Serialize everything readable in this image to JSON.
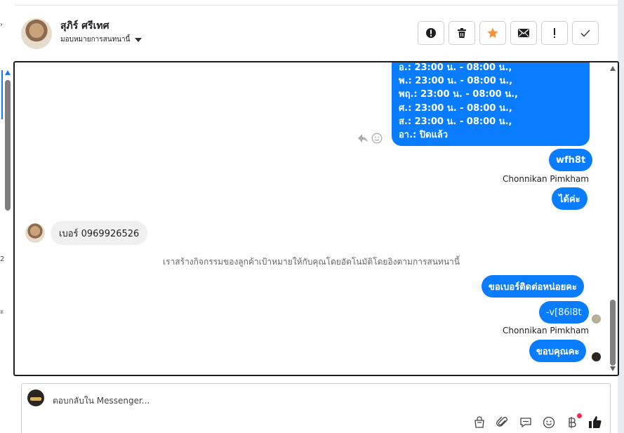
{
  "header": {
    "contact_name": "สุภิร์ ศรีเทศ",
    "assign_label": "มอบหมายการสนทนานี้",
    "actions": [
      {
        "name": "alert-icon",
        "title": "Alert"
      },
      {
        "name": "trash-icon",
        "title": "Delete"
      },
      {
        "name": "star-icon",
        "title": "Star"
      },
      {
        "name": "mail-icon",
        "title": "Mark unread"
      },
      {
        "name": "exclamation-icon",
        "title": "Spam"
      },
      {
        "name": "checkmark-icon",
        "title": "Done"
      }
    ],
    "star_color": "#f7923a"
  },
  "left_strip": {
    "mark_1": "›",
    "mark_2": "2",
    "mark_3": "ะ"
  },
  "chat": {
    "schedule_lines": [
      "อ.: 23:00 น. - 08:00 น.,",
      "พ.: 23:00 น. - 08:00 น.,",
      "พฤ.: 23:00 น. - 08:00 น.,",
      "ศ.: 23:00 น. - 08:00 น.,",
      "ส.: 23:00 น. - 08:00 น.,",
      "อา.: ปิดแล้ว"
    ],
    "msg_wfh8t": "wfh8t",
    "sender_1": "Chonnikan Pimkham",
    "msg_ok": "ได้ค่ะ",
    "incoming_phone": "เบอร์ 0969926526",
    "system_message": "เราสร้างกิจกรรมของลูกค้าเป้าหมายให้กับคุณโดยอัตโนมัติโดยอิงตามการสนทนานี้",
    "msg_ask_number": "ขอเบอร์ติดต่อหน่อยคะ",
    "msg_v86l8t": "-v[86l8t",
    "sender_2": "Chonnikan Pimkham",
    "msg_thanks": "ขอบคุณคะ",
    "bubble_color": "#0a7cff"
  },
  "composer": {
    "placeholder": "ตอบกลับใน Messenger...",
    "tools": [
      "bag-icon",
      "paperclip-icon",
      "chat-bubble-icon",
      "smiley-icon",
      "baht-icon",
      "like-icon"
    ]
  }
}
